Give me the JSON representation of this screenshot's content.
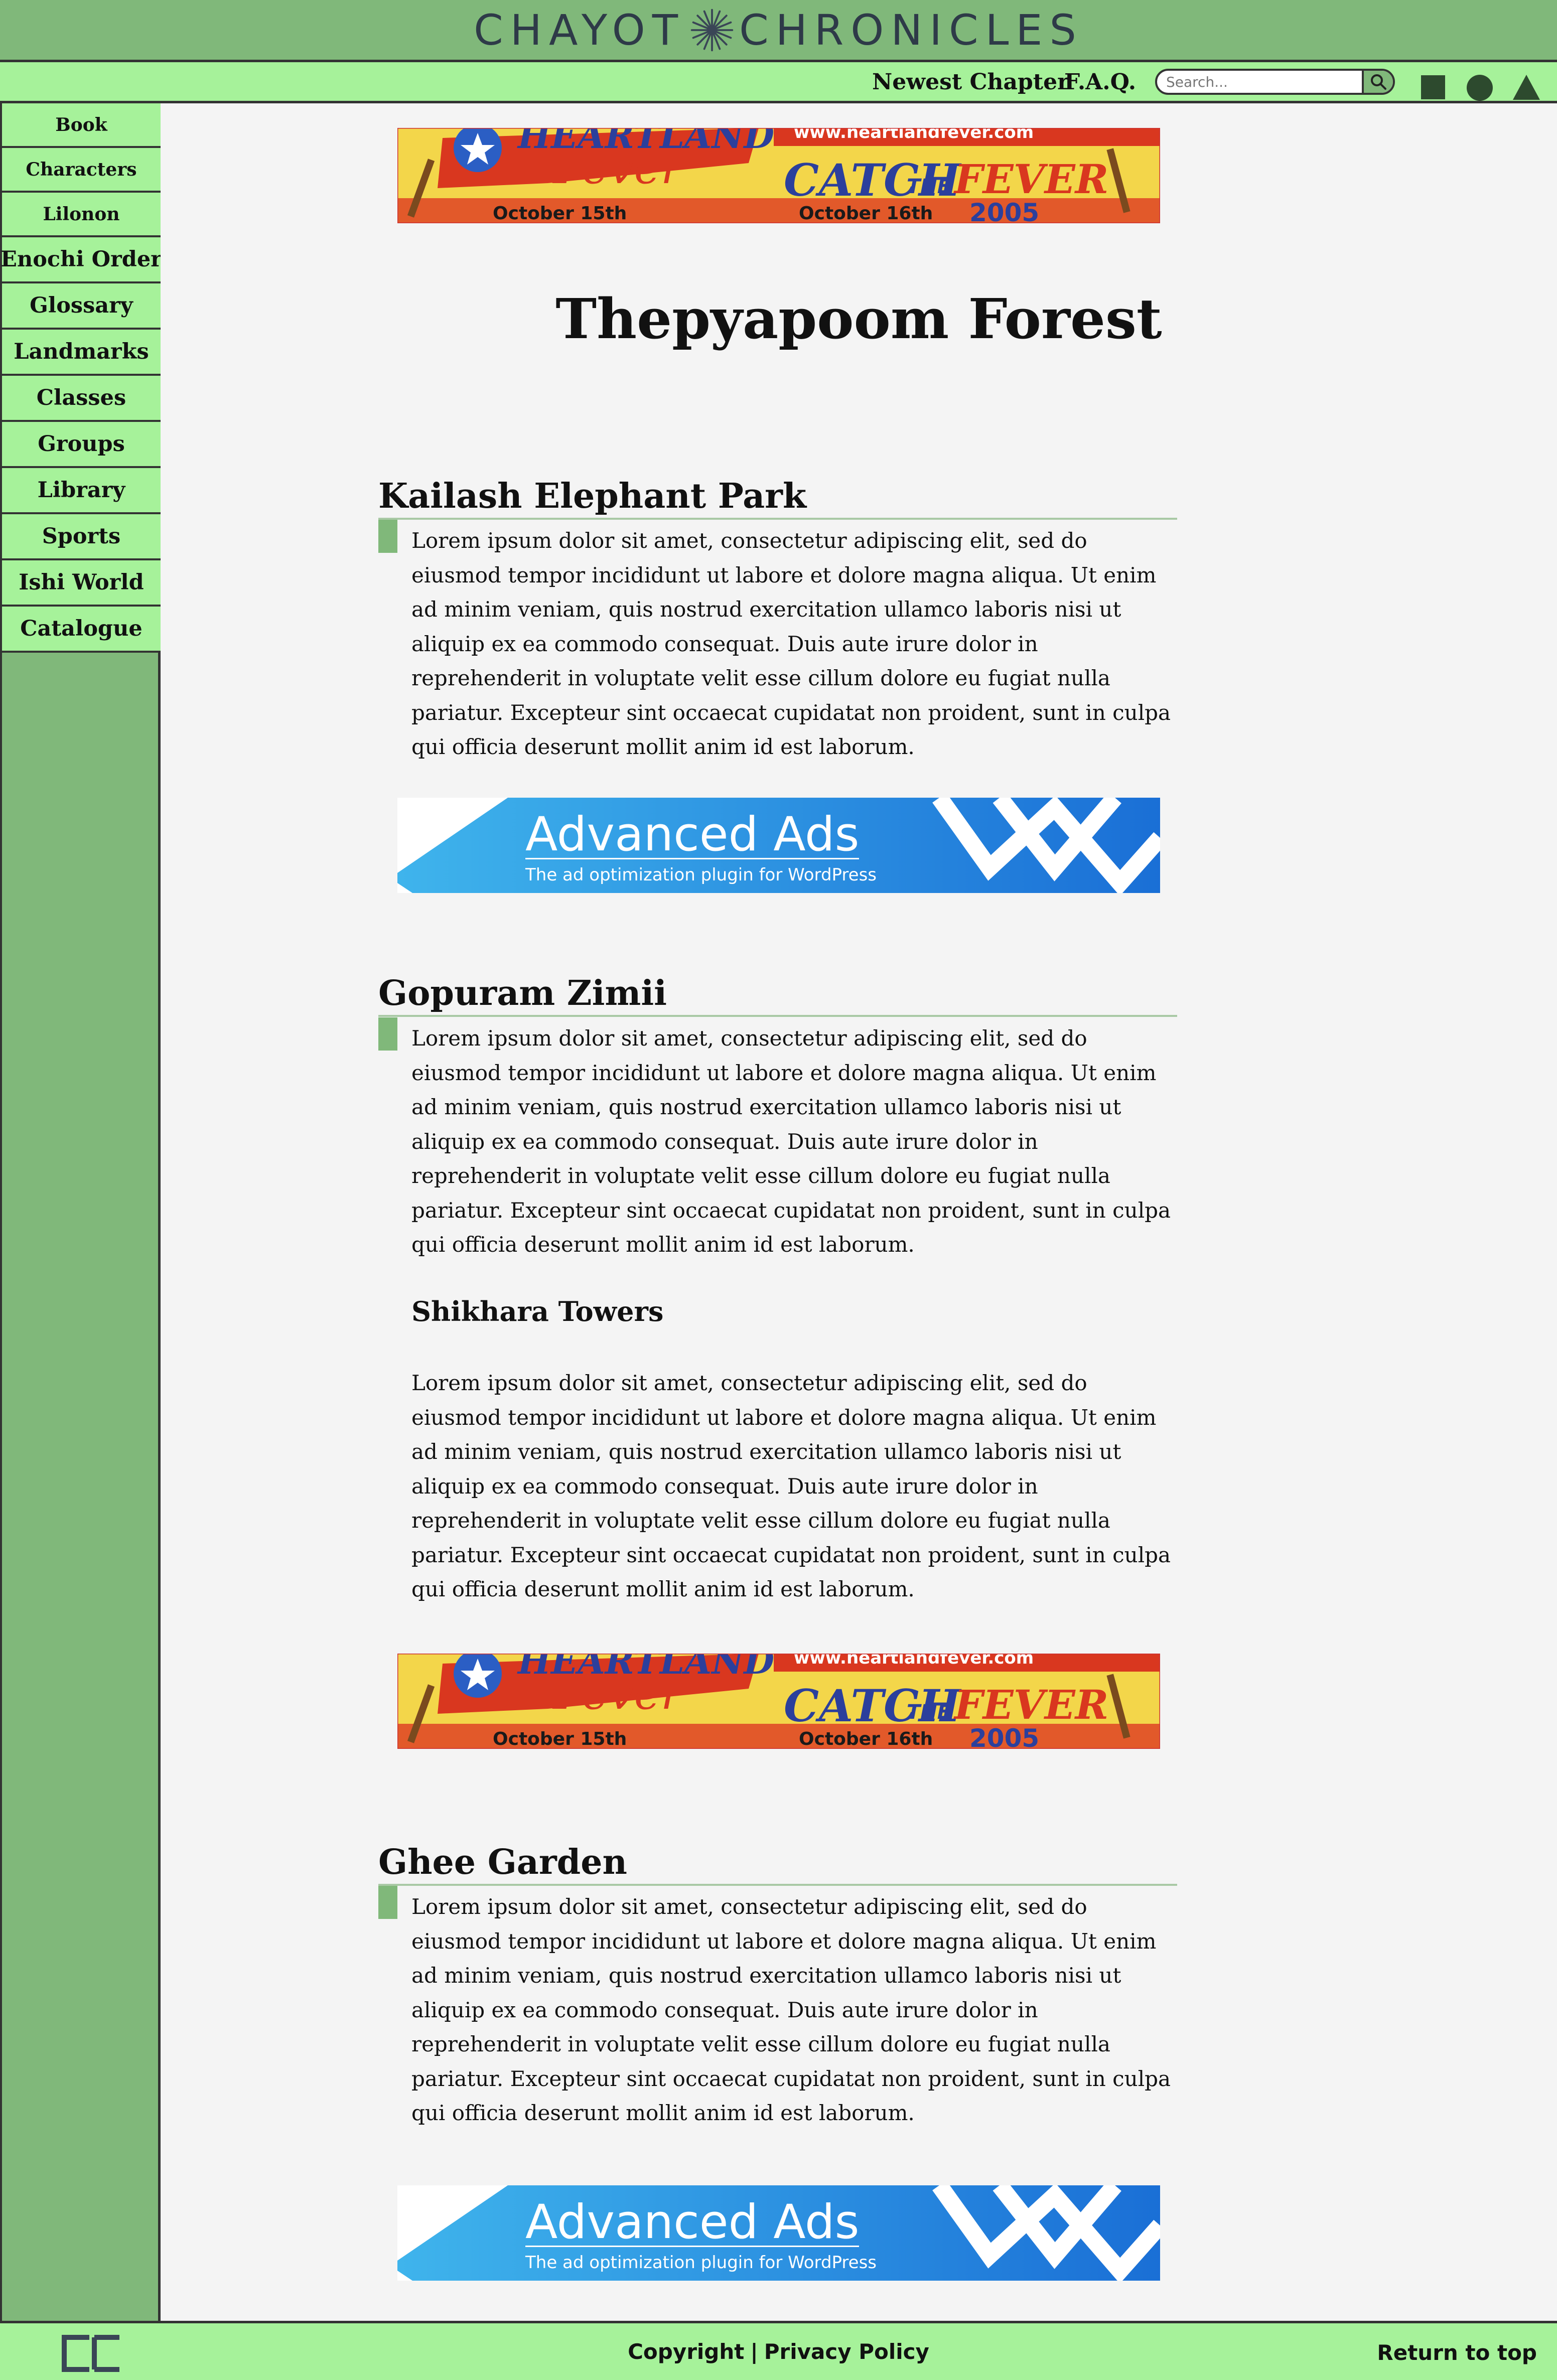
{
  "site": {
    "title": "CHAYOT CHRONICLES",
    "title_part1": "CHAYOT",
    "title_part2": "CHRONICLES"
  },
  "topnav": {
    "newest_chapter": "Newest Chapter",
    "faq": "F.A.Q.",
    "search_placeholder": "Search...",
    "icons": [
      "search-icon",
      "square-icon",
      "circle-icon",
      "triangle-icon"
    ]
  },
  "sidebar": {
    "items": [
      {
        "label": "Book"
      },
      {
        "label": "Characters"
      },
      {
        "label": "Lilonon"
      },
      {
        "label": "Enochi Order"
      },
      {
        "label": "Glossary"
      },
      {
        "label": "Landmarks"
      },
      {
        "label": "Classes"
      },
      {
        "label": "Groups"
      },
      {
        "label": "Library"
      },
      {
        "label": "Sports"
      },
      {
        "label": "Ishi World"
      },
      {
        "label": "Catalogue"
      }
    ]
  },
  "ads": {
    "heartland": {
      "title": "HEARTLAND",
      "subtitle": "Fever",
      "url": "www.heartlandfever.com",
      "tagline_left": "CATCH",
      "tagline_mid": "THE",
      "tagline_right": "FEVER",
      "date1": "October 15th",
      "date2": "October 16th",
      "year": "2005"
    },
    "advanced": {
      "title": "Advanced Ads",
      "subtitle": "The ad optimization plugin for WordPress"
    }
  },
  "main": {
    "page_title": "Thepyapoom Forest",
    "sections": [
      {
        "heading": "Kailash Elephant Park",
        "body": "Lorem ipsum dolor sit amet, consectetur adipiscing elit, sed do eiusmod tempor incididunt ut labore et dolore magna aliqua. Ut enim ad minim veniam, quis nostrud exercitation ullamco laboris nisi ut aliquip ex ea commodo consequat. Duis aute irure dolor in reprehenderit in voluptate velit esse cillum dolore eu fugiat nulla pariatur. Excepteur sint occaecat cupidatat non proident, sunt in culpa qui officia deserunt mollit anim id est laborum."
      },
      {
        "heading": "Gopuram Zimii",
        "body": "Lorem ipsum dolor sit amet, consectetur adipiscing elit, sed do eiusmod tempor incididunt ut labore et dolore magna aliqua. Ut enim ad minim veniam, quis nostrud exercitation ullamco laboris nisi ut aliquip ex ea commodo consequat. Duis aute irure dolor in reprehenderit in voluptate velit esse cillum dolore eu fugiat nulla pariatur. Excepteur sint occaecat cupidatat non proident, sunt in culpa qui officia deserunt mollit anim id est laborum.",
        "subsection": {
          "heading": "Shikhara Towers",
          "body": "Lorem ipsum dolor sit amet, consectetur adipiscing elit, sed do eiusmod tempor incididunt ut labore et dolore magna aliqua. Ut enim ad minim veniam, quis nostrud exercitation ullamco laboris nisi ut aliquip ex ea commodo consequat. Duis aute irure dolor in reprehenderit in voluptate velit esse cillum dolore eu fugiat nulla pariatur. Excepteur sint occaecat cupidatat non proident, sunt in culpa qui officia deserunt mollit anim id est laborum."
        }
      },
      {
        "heading": "Ghee Garden",
        "body": "Lorem ipsum dolor sit amet, consectetur adipiscing elit, sed do eiusmod tempor incididunt ut labore et dolore magna aliqua. Ut enim ad minim veniam, quis nostrud exercitation ullamco laboris nisi ut aliquip ex ea commodo consequat. Duis aute irure dolor in reprehenderit in voluptate velit esse cillum dolore eu fugiat nulla pariatur. Excepteur sint occaecat cupidatat non proident, sunt in culpa qui officia deserunt mollit anim id est laborum."
      }
    ]
  },
  "footer": {
    "copyright": "Copyright",
    "separator": "|",
    "privacy": "Privacy Policy",
    "return_top": "Return to top"
  },
  "colors": {
    "header_green": "#80b87a",
    "light_green": "#a6f29a",
    "page_bg": "#f4f4f4",
    "border": "#333333",
    "title_slate": "#2e3a48"
  }
}
